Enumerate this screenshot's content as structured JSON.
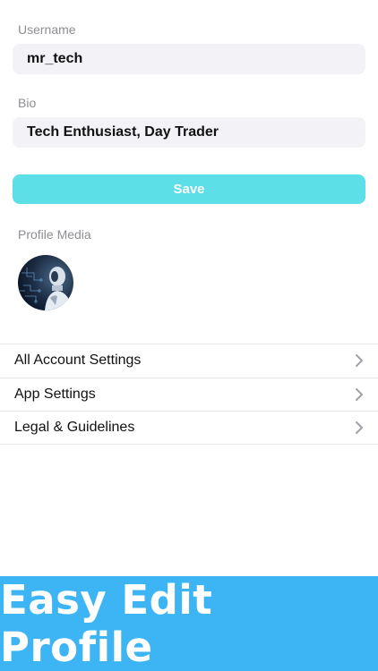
{
  "profile": {
    "username_label": "Username",
    "username_value": "mr_tech",
    "bio_label": "Bio",
    "bio_value": "Tech Enthusiast, Day Trader",
    "save_label": "Save",
    "media_label": "Profile Media"
  },
  "menu": {
    "items": [
      {
        "label": "All Account Settings",
        "icon": "chevron-right-icon"
      },
      {
        "label": "App Settings",
        "icon": "chevron-right-icon"
      },
      {
        "label": "Legal & Guidelines",
        "icon": "chevron-right-icon"
      }
    ]
  },
  "banner": {
    "text": "Easy Edit Profile"
  },
  "colors": {
    "accent": "#5cdfe6",
    "banner": "#3db5f5",
    "input_bg": "#f2f2f7"
  }
}
